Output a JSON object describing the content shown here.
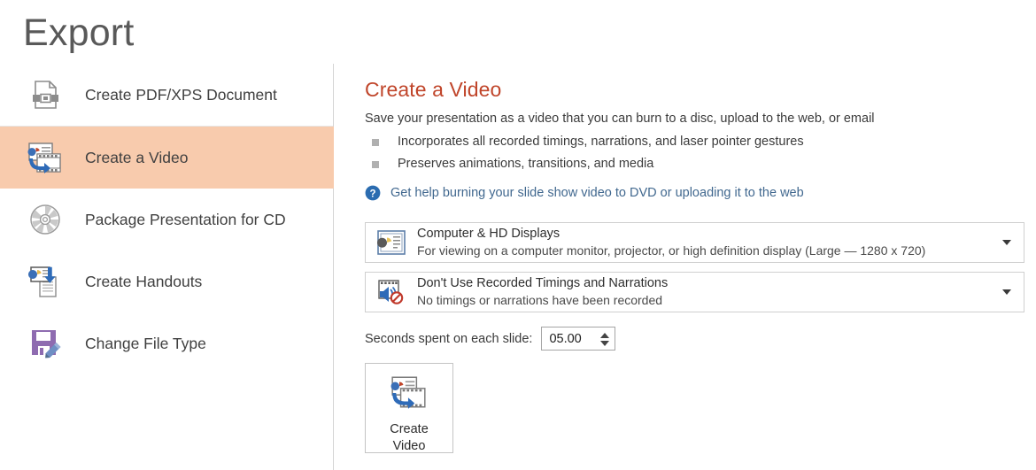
{
  "page": {
    "title": "Export"
  },
  "sidebar": {
    "items": [
      {
        "label": "Create PDF/XPS Document",
        "icon": "pdf-document-icon",
        "selected": false
      },
      {
        "label": "Create a Video",
        "icon": "create-video-icon",
        "selected": true
      },
      {
        "label": "Package Presentation for CD",
        "icon": "cd-disc-icon",
        "selected": false
      },
      {
        "label": "Create Handouts",
        "icon": "create-handouts-icon",
        "selected": false
      },
      {
        "label": "Change File Type",
        "icon": "change-file-type-icon",
        "selected": false
      }
    ]
  },
  "content": {
    "heading": "Create a Video",
    "subtitle": "Save your presentation as a video that you can burn to a disc, upload to the web, or email",
    "bullets": [
      "Incorporates all recorded timings, narrations, and laser pointer gestures",
      "Preserves animations, transitions, and media"
    ],
    "help_link": "Get help burning your slide show video to DVD or uploading it to the web",
    "quality_dropdown": {
      "title": "Computer & HD Displays",
      "description": "For viewing on a computer monitor, projector, or high definition display  (Large — 1280 x 720)",
      "icon": "display-quality-icon"
    },
    "timings_dropdown": {
      "title": "Don't Use Recorded Timings and Narrations",
      "description": "No timings or narrations have been recorded",
      "icon": "no-narration-icon"
    },
    "seconds": {
      "label": "Seconds spent on each slide:",
      "value": "05.00",
      "placeholder": "00.00"
    },
    "create_video_button": {
      "line1": "Create",
      "line2": "Video",
      "icon": "create-video-icon"
    }
  },
  "colors": {
    "selected_highlight": "#f8cbad",
    "heading_accent": "#c0452a",
    "link_blue": "#41688f",
    "title_gray": "#595959"
  }
}
